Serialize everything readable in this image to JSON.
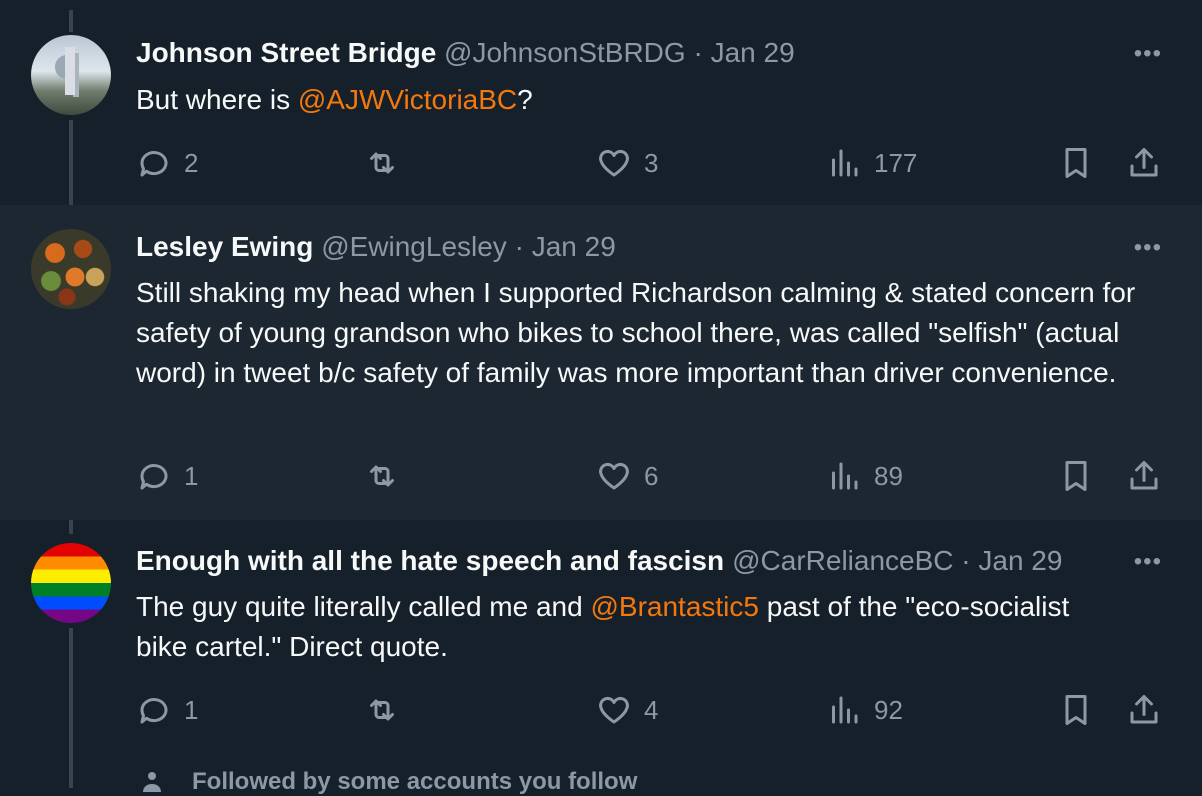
{
  "tweets": [
    {
      "name": "Johnson Street Bridge",
      "handle": "@JohnsonStBRDG",
      "date": "· Jan 29",
      "text_before": "But where is ",
      "mention": "@AJWVictoriaBC",
      "text_after": "?",
      "replies": "2",
      "retweets": "",
      "likes": "3",
      "views": "177",
      "avatar": "bridge-photo"
    },
    {
      "name": "Lesley Ewing",
      "handle": "@EwingLesley",
      "date": "· Jan 29",
      "text": "Still shaking my head when I supported Richardson calming & stated concern for safety of young grandson who bikes to school there, was called \"selfish\" (actual word) in tweet  b/c safety of family was more important than driver convenience.",
      "replies": "1",
      "retweets": "",
      "likes": "6",
      "views": "89",
      "avatar": "autumn-gourds-photo"
    },
    {
      "name": "Enough with all the hate speech and fascisn",
      "handle": "@CarRelianceBC",
      "date": "· Jan 29",
      "text_before": "The guy quite literally called me and ",
      "mention": "@Brantastic5",
      "text_after": " past of the \"eco-socialist bike cartel.\" Direct quote.",
      "replies": "1",
      "retweets": "",
      "likes": "4",
      "views": "92",
      "avatar": "rainbow-flag"
    }
  ],
  "more_label": "•••",
  "footer": {
    "text": "Followed by some accounts you follow",
    "icon": "person-icon"
  },
  "colors": {
    "background": "#15202b",
    "highlight": "#1c2732",
    "accent": "#f4780c",
    "muted": "#8b98a5"
  }
}
